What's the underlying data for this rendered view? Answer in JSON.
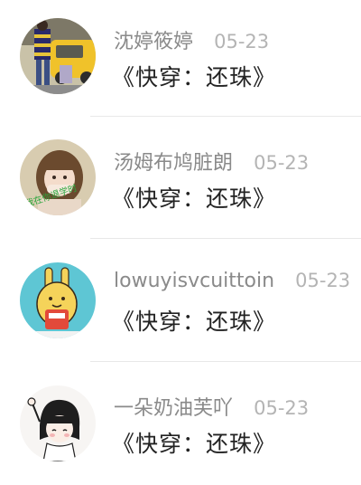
{
  "feed": {
    "items": [
      {
        "name": "沈婷筱婷",
        "date": "05-23",
        "title": "《快穿：还珠》",
        "avatar_icon": "avatar-photo-yellow-car-icon"
      },
      {
        "name": "汤姆布鸠脏朗",
        "date": "05-23",
        "title": "《快穿：还珠》",
        "avatar_icon": "avatar-photo-girl-icon",
        "avatar_overlay_text": "我在你退学时"
      },
      {
        "name": "lowuyisvcuittoin",
        "date": "05-23",
        "title": "《快穿：还珠》",
        "avatar_icon": "avatar-cartoon-rabbit-icon"
      },
      {
        "name": "一朵奶油芙吖",
        "date": "05-23",
        "title": "《快穿：还珠》",
        "avatar_icon": "avatar-sketch-girl-icon"
      }
    ]
  }
}
